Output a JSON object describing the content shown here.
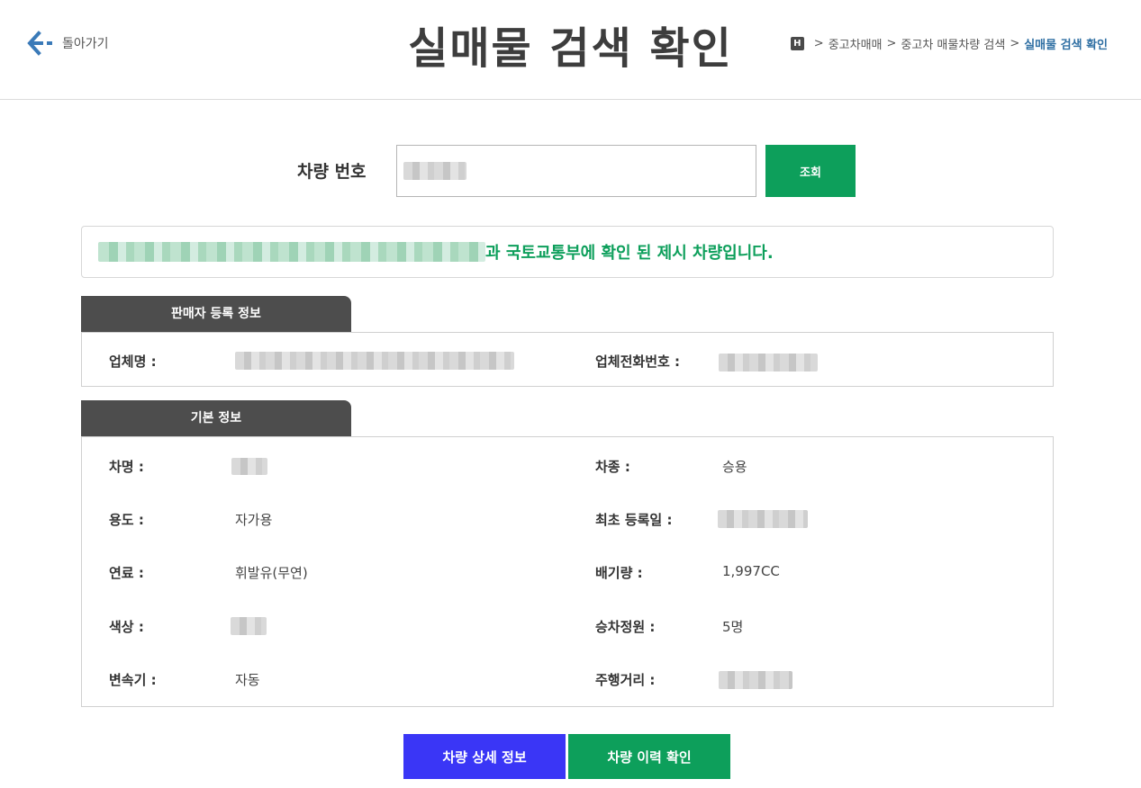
{
  "header": {
    "back_label": "돌아가기",
    "title": "실매물 검색 확인",
    "home_icon_letter": "H",
    "breadcrumb": [
      "중고차매매",
      "중고차 매물차량 검색",
      "실매물 검색 확인"
    ],
    "breadcrumb_sep": ">"
  },
  "search": {
    "label": "차량 번호",
    "value": "",
    "button_label": "조회"
  },
  "result": {
    "message": "과 국토교통부에 확인 된 제시 차량입니다."
  },
  "seller": {
    "tab_title": "판매자 등록 정보",
    "company_label": "업체명 :",
    "phone_label": "업체전화번호 :"
  },
  "basic": {
    "tab_title": "기본 정보",
    "rows": [
      {
        "left_label": "차명 :",
        "left_value": "",
        "right_label": "차종 :",
        "right_value": "승용"
      },
      {
        "left_label": "용도 :",
        "left_value": "자가용",
        "right_label": "최초 등록일 :",
        "right_value": ""
      },
      {
        "left_label": "연료 :",
        "left_value": "휘발유(무연)",
        "right_label": "배기량 :",
        "right_value": "1,997CC"
      },
      {
        "left_label": "색상 :",
        "left_value": "",
        "right_label": "승차정원 :",
        "right_value": "5명"
      },
      {
        "left_label": "변속기 :",
        "left_value": "자동",
        "right_label": "주행거리 :",
        "right_value": ""
      }
    ]
  },
  "actions": {
    "detail_button": "차량 상세 정보",
    "history_button": "차량 이력 확인"
  },
  "colors": {
    "accent_green": "#0d9f5b",
    "accent_blue": "#3a36f6",
    "link_blue": "#2f6fa3",
    "tab_dark": "#4d4d4d"
  },
  "icons": [
    "arrow-left-icon",
    "home-icon"
  ]
}
